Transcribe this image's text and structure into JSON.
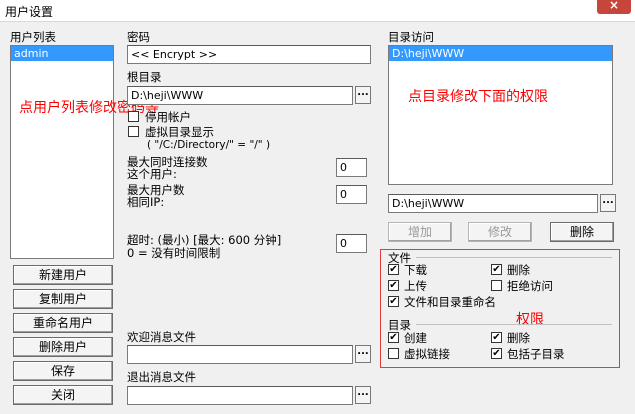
{
  "window": {
    "title": "用户设置",
    "close": "×"
  },
  "users": {
    "label": "用户列表",
    "items": [
      "admin"
    ],
    "note": "点用户列表修改密码等"
  },
  "buttons": {
    "new_user": "新建用户",
    "copy_user": "复制用户",
    "rename_user": "重命名用户",
    "delete_user": "删除用户",
    "save": "保存",
    "close": "关闭"
  },
  "password": {
    "label": "密码",
    "value": "<< Encrypt >>"
  },
  "root": {
    "label": "根目录",
    "value": "D:\\heji\\WWW",
    "browse": "..."
  },
  "options": {
    "disable_account": "停用帐户",
    "virtual_dir": "虚拟目录显示",
    "virtual_hint": "( \"/C:/Directory/\" = \"/\" )"
  },
  "limits": {
    "max_conn_label": "最大同时连接数\n这个用户:",
    "max_conn": "0",
    "max_ip_label": "最大用户数\n相同IP:",
    "max_ip": "0",
    "timeout_label": "超时: (最小) [最大: 600 分钟]\n0 = 没有时间限制",
    "timeout": "0"
  },
  "welcome": {
    "label": "欢迎消息文件",
    "value": "",
    "browse": "..."
  },
  "logout": {
    "label": "退出消息文件",
    "value": "",
    "browse": "..."
  },
  "dir_access": {
    "label": "目录访问",
    "items": [
      "D:\\heji\\WWW"
    ],
    "note": "点目录修改下面的权限",
    "path": "D:\\heji\\WWW",
    "browse": "...",
    "add": "增加",
    "edit": "修改",
    "delete": "删除"
  },
  "perms": {
    "note": "权限",
    "files_label": "文件",
    "download": "下载",
    "upload": "上传",
    "delete_file": "删除",
    "deny": "拒绝访问",
    "rename": "文件和目录重命名",
    "dir_label": "目录",
    "create": "创建",
    "delete_dir": "删除",
    "vlink": "虚拟链接",
    "subdirs": "包括子目录",
    "check": "✔"
  }
}
